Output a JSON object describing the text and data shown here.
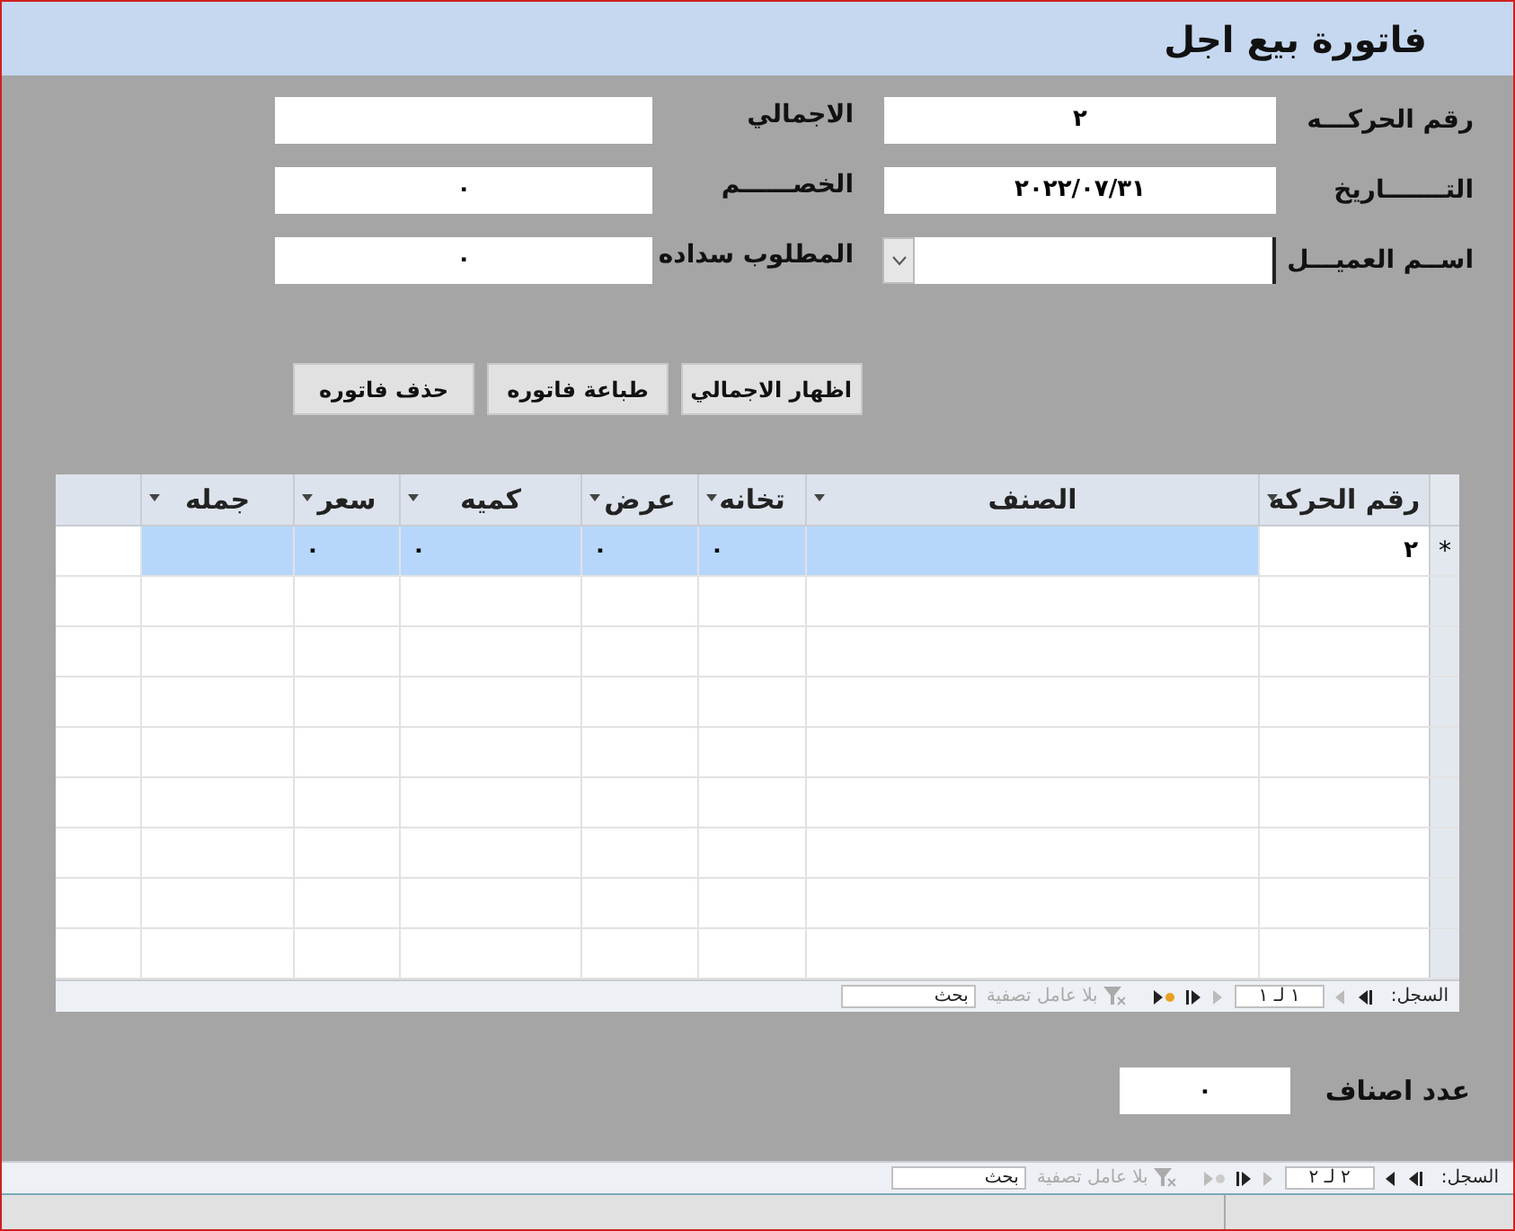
{
  "title": "فاتورة بيع اجل",
  "fields": [
    {
      "label": "رقم الحركـــه",
      "value": "٢",
      "kind": "text"
    },
    {
      "label": "الاجمالي",
      "kind": "text"
    },
    {
      "label": "التـــــــاريخ",
      "value": "٢٠٢٢/٠٧/٣١",
      "kind": "text"
    },
    {
      "label": "الخصــــــم",
      "value": "٠",
      "kind": "text"
    },
    {
      "label": "اســم العميـــل",
      "kind": "combo"
    },
    {
      "label": "المطلوب سداده",
      "value": "٠",
      "kind": "text"
    }
  ],
  "buttons": [
    "اظهار الاجمالي",
    "طباعة فاتوره",
    "حذف فاتوره"
  ],
  "table": {
    "columns": [
      "رقم الحركه",
      "الصنف",
      "تخانه",
      "عرض",
      "كميه",
      "سعر",
      "جمله"
    ],
    "rows": [
      {
        "marker": "*",
        "selected": true,
        "cells": [
          {
            "value": "٢",
            "focused": true
          },
          {
            "focused": false
          },
          {
            "value": "٠",
            "focused": false
          },
          {
            "value": "٠",
            "focused": false
          },
          {
            "value": "٠",
            "focused": false
          },
          {
            "value": "٠",
            "focused": false
          },
          {
            "focused": false
          }
        ]
      }
    ],
    "navigator": {
      "label": "السجل:",
      "position": "١ لـ ١",
      "filter": "بلا عامل تصفية",
      "search": "بحث"
    }
  },
  "count": {
    "label": "عدد اصناف",
    "value": "٠"
  },
  "navigator": {
    "label": "السجل:",
    "position": "٢ لـ ٢",
    "filter": "بلا عامل تصفية",
    "search": "بحث"
  }
}
